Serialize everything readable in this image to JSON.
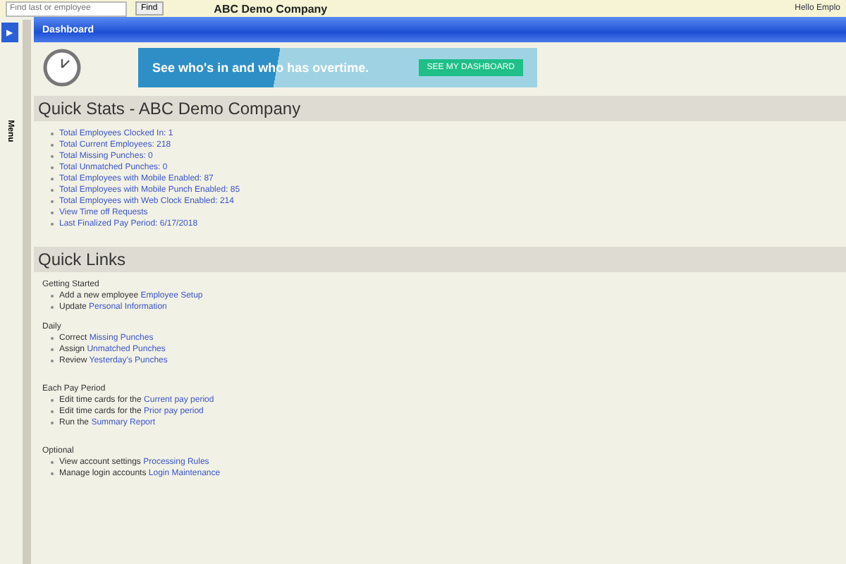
{
  "top_bar": {
    "search": {
      "placeholder": "Find last or employee"
    },
    "find_button": "Find",
    "company": "ABC Demo Company",
    "greeting": "Hello Emplo"
  },
  "sidebar": {
    "toggle": "▶",
    "label": "Menu"
  },
  "tab": {
    "title": "Dashboard"
  },
  "banner": {
    "text": "See who's in and who has overtime.",
    "button": "SEE MY DASHBOARD"
  },
  "quick_stats": {
    "title": "Quick Stats - ABC Demo Company",
    "items": [
      "Total Employees Clocked In: 1",
      "Total Current Employees: 218",
      "Total Missing Punches: 0",
      "Total Unmatched Punches: 0",
      "Total Employees with Mobile Enabled: 87",
      "Total Employees with Mobile Punch Enabled: 85",
      "Total Employees with Web Clock Enabled: 214",
      "View Time off Requests",
      "Last Finalized Pay Period: 6/17/2018"
    ]
  },
  "quick_links": {
    "title": "Quick Links",
    "groups": [
      {
        "heading": "Getting Started",
        "items": [
          {
            "text": "Add a new employee",
            "link": "Employee Setup"
          },
          {
            "text": "Update",
            "link": "Personal Information"
          }
        ]
      },
      {
        "heading": "Daily",
        "items": [
          {
            "text": "Correct",
            "link": "Missing Punches"
          },
          {
            "text": "Assign",
            "link": "Unmatched Punches"
          },
          {
            "text": "Review",
            "link": "Yesterday's Punches"
          }
        ]
      },
      {
        "heading": "Each Pay Period",
        "items": [
          {
            "text": "Edit time cards for the",
            "link": "Current pay period"
          },
          {
            "text": "Edit time cards for the",
            "link": "Prior pay period"
          },
          {
            "text": "Run the",
            "link": "Summary Report"
          }
        ]
      },
      {
        "heading": "Optional",
        "items": [
          {
            "text": "View account settings",
            "link": "Processing Rules"
          },
          {
            "text": "Manage login accounts",
            "link": "Login Maintenance"
          }
        ]
      }
    ]
  }
}
